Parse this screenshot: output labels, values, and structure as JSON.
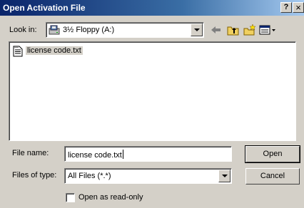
{
  "window": {
    "title": "Open Activation File",
    "help_label": "?",
    "close_label": "×"
  },
  "toolbar": {
    "look_in_label": "Look in:",
    "look_in_value": "3½ Floppy (A:)",
    "look_in_icon": "floppy-drive-icon",
    "tool_icons": [
      "back-icon",
      "up-folder-icon",
      "new-folder-icon",
      "views-menu-icon"
    ]
  },
  "file_list": {
    "items": [
      {
        "label": "license code.txt",
        "icon": "text-file-icon",
        "selected": true
      }
    ]
  },
  "form": {
    "file_name_label": "File name:",
    "file_name_value": "license code.txt",
    "files_of_type_label": "Files of type:",
    "files_of_type_value": "All Files (*.*)",
    "read_only_label": "Open as read-only",
    "read_only_checked": false
  },
  "buttons": {
    "open_label": "Open",
    "cancel_label": "Cancel"
  },
  "colors": {
    "dialog_face": "#d4d0c8",
    "title_start": "#0a246a",
    "title_end": "#a6caf0",
    "title_text": "#ffffff"
  }
}
